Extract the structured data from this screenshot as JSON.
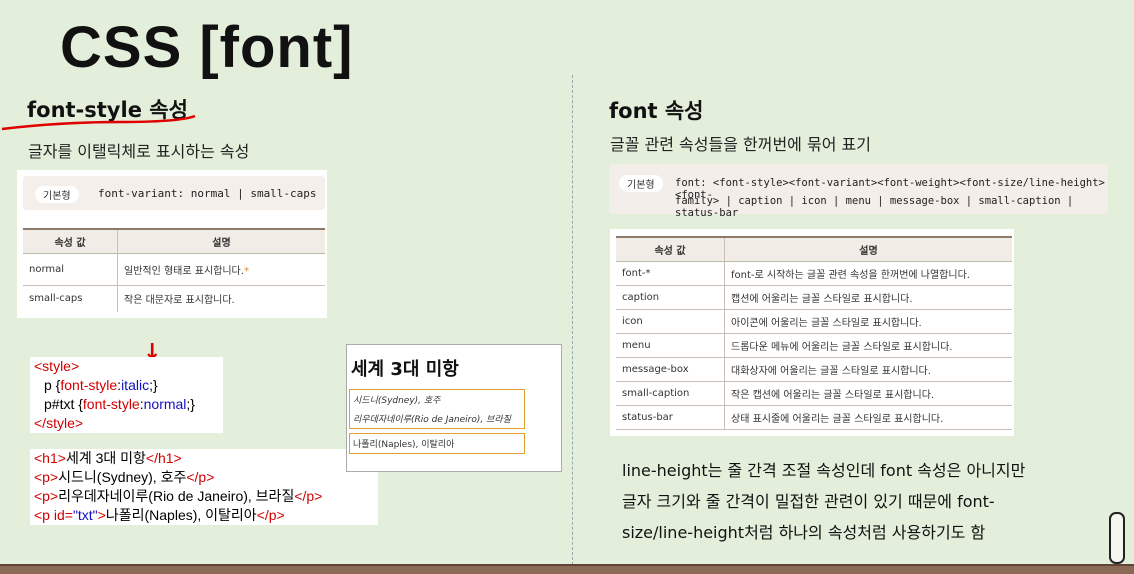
{
  "slide": {
    "title": "CSS [font]"
  },
  "left": {
    "heading": "font-style 속성",
    "description": "글자를 이탤릭체로 표시하는 속성",
    "syntax": {
      "tag": "기본형",
      "code": "font-variant: normal | small-caps"
    },
    "table": {
      "headers": [
        "속성 값",
        "설명"
      ],
      "rows": [
        {
          "value": "normal",
          "desc": "일반적인 형태로 표시합니다.",
          "mark": "*"
        },
        {
          "value": "small-caps",
          "desc": "작은 대문자로 표시합니다.",
          "mark": ""
        }
      ]
    },
    "code": {
      "style_open": "<style>",
      "rule1_selector": "p {",
      "rule1_prop": "font-style",
      "rule1_colon": ":",
      "rule1_val": "italic",
      "rule1_end": ";}",
      "rule2_selector": "p#txt {",
      "rule2_prop": "font-style",
      "rule2_colon": ":",
      "rule2_val": "normal",
      "rule2_end": ";}",
      "style_close": "</style>",
      "h1_open": "<h1>",
      "h1_text": "세계 3대 미항",
      "h1_close": "</h1>",
      "p1_open": "<p>",
      "p1_text": "시드니(Sydney), 호주",
      "p1_close": "</p>",
      "p2_open": "<p>",
      "p2_text": "리우데자네이루(Rio de Janeiro), 브라질",
      "p2_close": "</p>",
      "p3_open": "<p ",
      "p3_attr": "id=",
      "p3_attrv": "\"txt\"",
      "p3_gt": ">",
      "p3_text": "나폴리(Naples), 이탈리아",
      "p3_close": "</p>"
    },
    "arrows": [
      "↓",
      "↓"
    ],
    "result": {
      "title": "세계 3대 미항",
      "lines": [
        "시드니(Sydney), 호주",
        "리우데자네이루(Rio de Janeiro), 브라질",
        "나폴리(Naples), 이탈리아"
      ]
    }
  },
  "right": {
    "heading": "font 속성",
    "description": "글꼴 관련 속성들을 한꺼번에 묶어 표기",
    "syntax": {
      "tag": "기본형",
      "line1": "font:  <font-style><font-variant><font-weight><font-size/line-height><font-",
      "line2": "family> | caption | icon | menu | message-box | small-caption | status-bar"
    },
    "table": {
      "headers": [
        "속성 값",
        "설명"
      ],
      "rows": [
        {
          "value": "font-*",
          "desc": "font-로 시작하는 글꼴 관련 속성을 한꺼번에 나열합니다."
        },
        {
          "value": "caption",
          "desc": "캡션에 어울리는 글꼴 스타일로 표시합니다."
        },
        {
          "value": "icon",
          "desc": "아이콘에 어울리는 글꼴 스타일로 표시합니다."
        },
        {
          "value": "menu",
          "desc": "드롭다운 메뉴에 어울리는 글꼴 스타일로 표시합니다."
        },
        {
          "value": "message-box",
          "desc": "대화상자에 어울리는 글꼴 스타일로 표시합니다."
        },
        {
          "value": "small-caption",
          "desc": "작은 캡션에 어울리는 글꼴 스타일로 표시합니다."
        },
        {
          "value": "status-bar",
          "desc": "상태 표시줄에 어울리는 글꼴 스타일로 표시합니다."
        }
      ]
    },
    "note": [
      "line-height는 줄 간격 조절 속성인데 font 속성은 아니지만",
      "글자 크기와 줄 간격이 밀접한 관련이 있기 때문에 font-",
      "size/line-height처럼 하나의 속성처럼 사용하기도 함"
    ]
  },
  "colors": {
    "background": "#e3eedb",
    "accent_red": "#d10000",
    "code_blue": "#1010c0",
    "table_header": "#f1ece6"
  }
}
